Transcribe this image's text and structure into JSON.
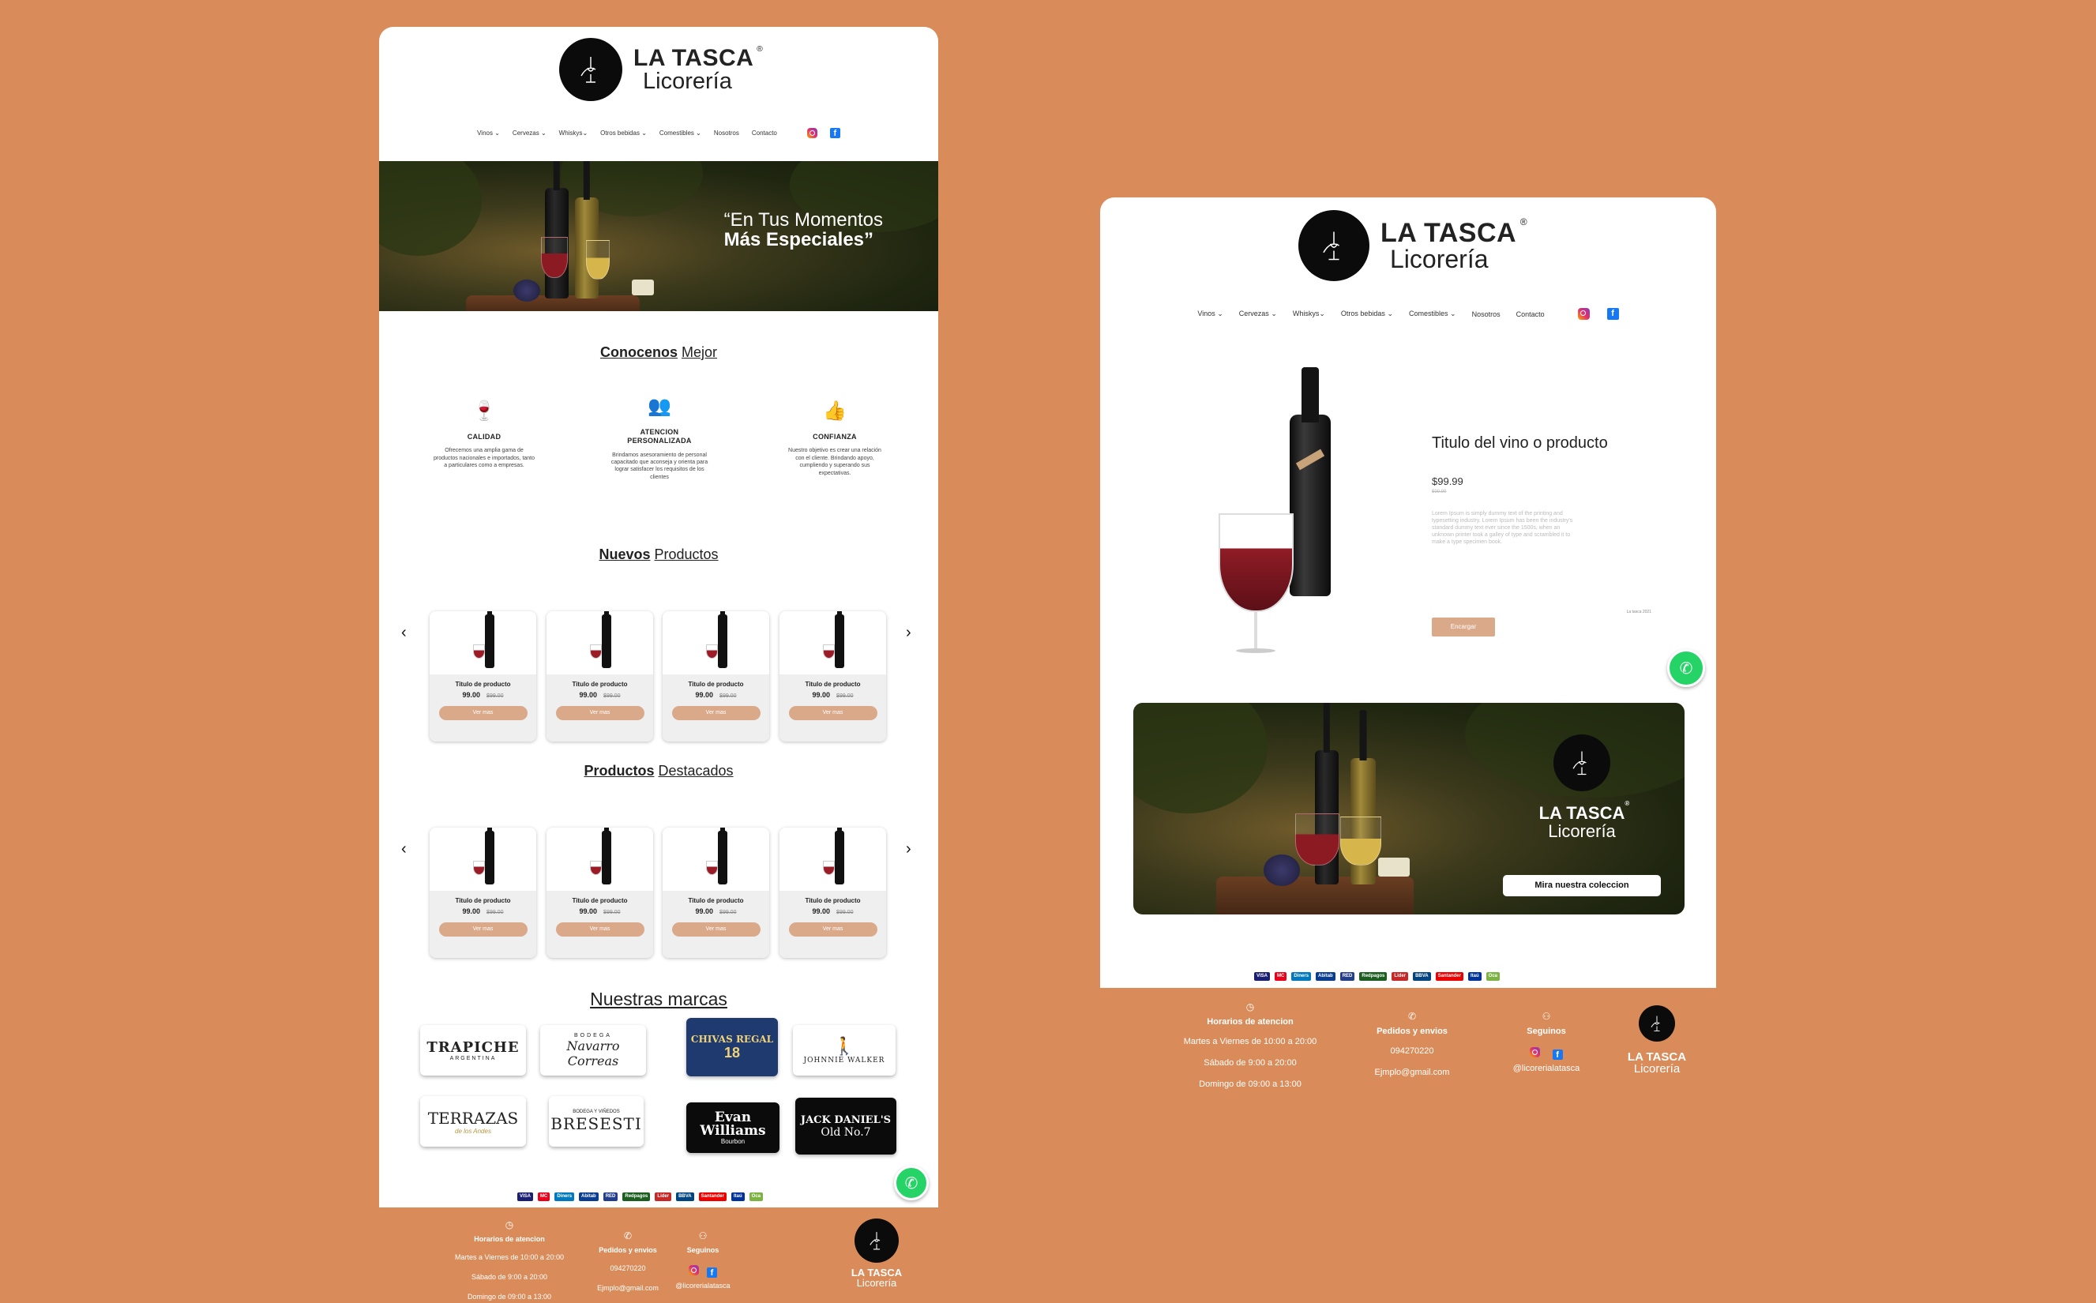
{
  "brand": {
    "name": "LA TASCA",
    "registered": "®",
    "subtitle": "Licorería"
  },
  "nav": {
    "items": [
      "Vinos",
      "Cervezas",
      "Whiskys",
      "Otros bebidas",
      "Comestibles",
      "Nosotros",
      "Contacto"
    ],
    "dropdown_marker": "⌄",
    "social_icons": [
      "instagram-icon",
      "facebook-icon"
    ]
  },
  "hero": {
    "line1": "“En Tus Momentos",
    "line2": "Más Especiales”"
  },
  "about": {
    "title_bold": "Conocenos",
    "title_rest": "Mejor",
    "features": [
      {
        "icon": "wine-glasses-icon",
        "title": "CALIDAD",
        "desc": "Ofrecemos una amplia gama de productos nacionales e importados, tanto a particulares como a empresas."
      },
      {
        "icon": "people-icon",
        "title": "ATENCION PERSONALIZADA",
        "desc": "Brindamos asesoramiento de personal capacitado que aconseja y orienta para lograr satisfacer los requisitos de los clientes"
      },
      {
        "icon": "thumbs-up-icon",
        "title": "CONFIANZA",
        "desc": "Nuestro objetivo es crear una relación con el cliente. Brindando apoyo, cumpliendo y superando sus expectativas."
      }
    ]
  },
  "new_products": {
    "title_bold": "Nuevos",
    "title_rest": "Productos",
    "cards": [
      {
        "title": "Titulo de producto",
        "price": "99.00",
        "old_price": "$99.00",
        "button": "Ver mas"
      },
      {
        "title": "Titulo de producto",
        "price": "99.00",
        "old_price": "$99.00",
        "button": "Ver mas"
      },
      {
        "title": "Titulo de producto",
        "price": "99.00",
        "old_price": "$99.00",
        "button": "Ver mas"
      },
      {
        "title": "Titulo de producto",
        "price": "99.00",
        "old_price": "$99.00",
        "button": "Ver mas"
      }
    ]
  },
  "featured_products": {
    "title_bold": "Productos",
    "title_rest": "Destacados",
    "cards": [
      {
        "title": "Titulo de producto",
        "price": "99.00",
        "old_price": "$99.00",
        "button": "Ver mas"
      },
      {
        "title": "Titulo de producto",
        "price": "99.00",
        "old_price": "$99.00",
        "button": "Ver mas"
      },
      {
        "title": "Titulo de producto",
        "price": "99.00",
        "old_price": "$99.00",
        "button": "Ver mas"
      },
      {
        "title": "Titulo de producto",
        "price": "99.00",
        "old_price": "$99.00",
        "button": "Ver mas"
      }
    ]
  },
  "carousel": {
    "prev": "‹",
    "next": "›"
  },
  "brands": {
    "title": "Nuestras marcas",
    "items": [
      {
        "line1": "TRAPICHE",
        "line2": "ARGENTINA"
      },
      {
        "line1": "BODEGA",
        "line2": "Navarro Correas"
      },
      {
        "line1": "CHIVAS REGAL",
        "line2": "18"
      },
      {
        "line1": "JOHNNIE WALKER",
        "line2": ""
      },
      {
        "line1": "TERRAZAS",
        "line2": "de los Andes"
      },
      {
        "line1": "BRESESTI",
        "line2": "BODEGA Y VIÑEDOS"
      },
      {
        "line1": "Evan Williams",
        "line2": "Bourbon"
      },
      {
        "line1": "JACK DANIEL'S",
        "line2": "Old No.7"
      }
    ]
  },
  "payments": [
    {
      "label": "VISA",
      "color": "#1a1f71"
    },
    {
      "label": "MC",
      "color": "#eb001b"
    },
    {
      "label": "Diners",
      "color": "#0079be"
    },
    {
      "label": "Abitab",
      "color": "#0a3d8f"
    },
    {
      "label": "RED",
      "color": "#233e8b"
    },
    {
      "label": "Redpagos",
      "color": "#1b5e20"
    },
    {
      "label": "Lider",
      "color": "#c62828"
    },
    {
      "label": "BBVA",
      "color": "#004481"
    },
    {
      "label": "Santander",
      "color": "#ec0000"
    },
    {
      "label": "Itaú",
      "color": "#003399"
    },
    {
      "label": "Oca",
      "color": "#7cb342"
    }
  ],
  "footer": {
    "hours_title": "Horarios de atencion",
    "hours": [
      "Martes a Viernes de 10:00 a 20:00",
      "Sábado de 9:00 a 20:00",
      "Domingo de 09:00 a 13:00"
    ],
    "orders_title": "Pedidos y envios",
    "phone": "094270220",
    "email": "Ejmplo@gmail.com",
    "follow_title": "Seguinos",
    "handle": "@licorerialatasca"
  },
  "product_detail": {
    "title": "Titulo del vino o producto",
    "price": "$99.99",
    "old_price": "$99.99",
    "description": "Lorem Ipsum is simply dummy text of the printing and typesetting industry. Lorem Ipsum has been the industry's standard dummy text ever since the 1500s, when an unknown printer took a galley of type and scrambled it to make a type specimen book.",
    "button": "Encargar",
    "note": "La tasca 2021"
  },
  "banner": {
    "cta": "Mira nuestra coleccion"
  },
  "colors": {
    "background": "#D98C5A",
    "button": "#DAA98A",
    "whatsapp": "#25D366"
  }
}
